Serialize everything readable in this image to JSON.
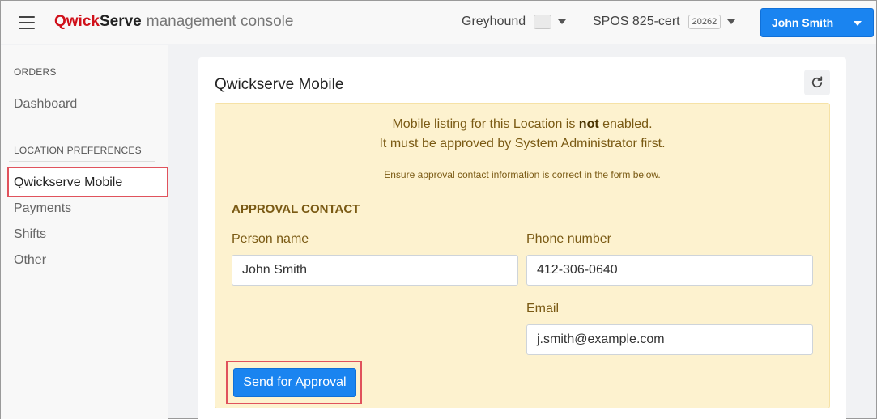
{
  "header": {
    "brand_part1": "Qwick",
    "brand_part2": "Serve",
    "brand_subtitle": "management console",
    "location_name": "Greyhound",
    "pos_name": "SPOS 825-cert",
    "pos_badge": "20262",
    "user_name": "John Smith"
  },
  "sidebar": {
    "section_orders": "ORDERS",
    "dashboard": "Dashboard",
    "section_location": "LOCATION PREFERENCES",
    "items": [
      "Qwickserve Mobile",
      "Payments",
      "Shifts",
      "Other"
    ]
  },
  "main": {
    "title": "Qwickserve Mobile",
    "notice_line1_pre": "Mobile listing for this Location is ",
    "notice_line1_bold": "not",
    "notice_line1_post": " enabled.",
    "notice_line2": "It must be approved by System Administrator first.",
    "notice_small": "Ensure approval contact information is correct in the form below.",
    "contact_heading": "APPROVAL CONTACT",
    "person_label": "Person name",
    "person_value": "John Smith",
    "phone_label": "Phone number",
    "phone_value": "412-306-0640",
    "email_label": "Email",
    "email_value": "j.smith@example.com",
    "submit_label": "Send for Approval"
  },
  "colors": {
    "brand_red": "#d0101a",
    "primary_blue": "#1a84f0",
    "warning_bg": "#fdf2cf",
    "highlight_red": "#e0525c"
  },
  "icons": {
    "menu": "hamburger-menu-icon",
    "refresh": "refresh-icon",
    "dropdown": "chevron-down-icon"
  }
}
